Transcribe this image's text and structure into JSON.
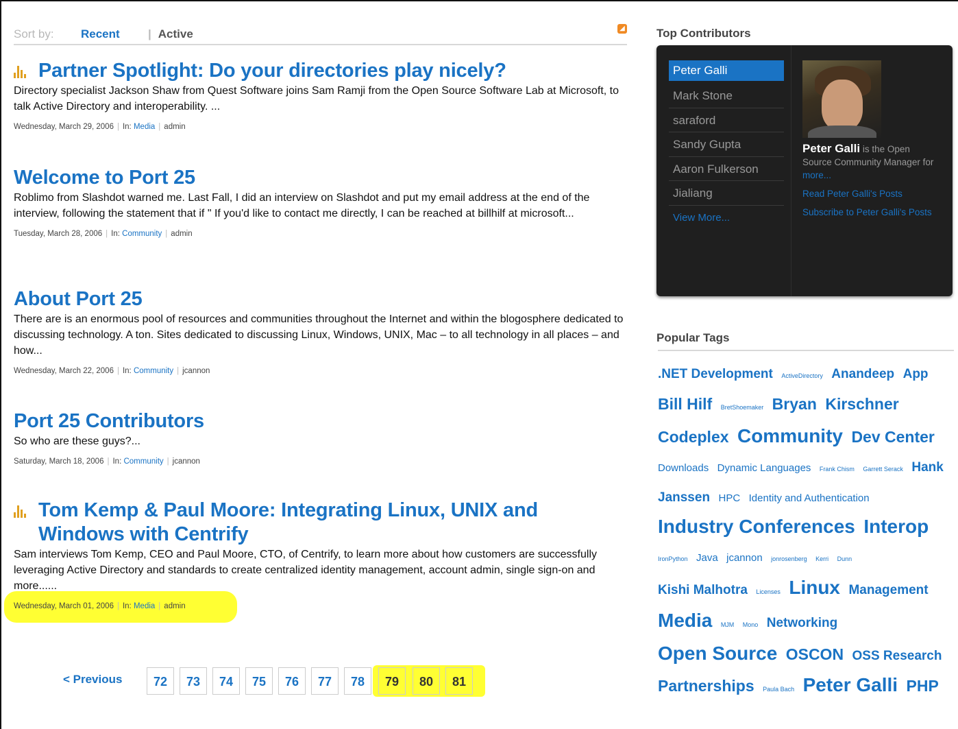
{
  "sort": {
    "label": "Sort by:",
    "recent": "Recent",
    "separator": "|",
    "active": "Active",
    "rss_icon": "rss-icon"
  },
  "posts": [
    {
      "title": "Partner Spotlight: Do your directories play nicely?",
      "featured": true,
      "excerpt": "Directory specialist Jackson Shaw from Quest Software joins Sam Ramji from the Open Source Software Lab at Microsoft, to talk Active Directory and interoperability. ...",
      "date": "Wednesday, March 29, 2006",
      "in": "In:",
      "category": "Media",
      "author": "admin"
    },
    {
      "title": "Welcome to Port 25",
      "featured": false,
      "excerpt": "Roblimo from Slashdot warned me. Last Fall, I did an interview on Slashdot and put my email address at the end of the interview, following the statement that if \" If you'd like to contact me directly, I can be reached at billhilf at microsoft...",
      "date": "Tuesday, March 28, 2006",
      "in": "In:",
      "category": "Community",
      "author": "admin"
    },
    {
      "title": "About Port 25",
      "featured": false,
      "excerpt": "There are is an enormous pool of resources and communities throughout the Internet and within the blogosphere dedicated to discussing technology. A ton. Sites dedicated to discussing Linux, Windows, UNIX, Mac – to all technology in all places – and how...",
      "date": "Wednesday, March 22, 2006",
      "in": "In:",
      "category": "Community",
      "author": "jcannon"
    },
    {
      "title": "Port 25 Contributors",
      "featured": false,
      "excerpt": "So who are these guys?...",
      "date": "Saturday, March 18, 2006",
      "in": "In:",
      "category": "Community",
      "author": "jcannon"
    },
    {
      "title": "Tom Kemp & Paul Moore: Integrating Linux, UNIX and Windows with Centrify",
      "featured": true,
      "excerpt": "Sam interviews Tom Kemp, CEO and Paul Moore, CTO, of Centrify, to learn more about how customers are successfully leveraging Active Directory and standards to create centralized identity management, account admin, single sign-on and more......",
      "date": "Wednesday, March 01, 2006",
      "in": "In:",
      "category": "Media",
      "author": "admin"
    }
  ],
  "pager": {
    "previous": "< Previous",
    "pages": [
      "72",
      "73",
      "74",
      "75",
      "76",
      "77",
      "78",
      "79",
      "80",
      "81"
    ]
  },
  "contributors": {
    "heading": "Top Contributors",
    "names": [
      "Peter Galli",
      "Mark Stone",
      "saraford",
      "Sandy Gupta",
      "Aaron Fulkerson",
      "Jialiang"
    ],
    "view_more": "View More...",
    "selected_name": "Peter Galli",
    "bio": "is the Open Source Community Manager for",
    "bio_more": "more...",
    "read_posts": "Read Peter Galli's Posts",
    "subscribe": "Subscribe to Peter Galli's Posts"
  },
  "tags": {
    "heading": "Popular Tags",
    "items": [
      [
        ".NET Development",
        3
      ],
      [
        "ActiveDirectory",
        1
      ],
      [
        "Anandeep",
        3
      ],
      [
        "App",
        3
      ],
      [
        "Bill Hilf",
        4
      ],
      [
        "BretShoemaker",
        1
      ],
      [
        "Bryan",
        4
      ],
      [
        "Kirschner",
        4
      ],
      [
        "Codeplex",
        4
      ],
      [
        "Community",
        5
      ],
      [
        "Dev Center",
        4
      ],
      [
        "Downloads",
        2
      ],
      [
        "Dynamic Languages",
        2
      ],
      [
        "Frank Chism",
        1
      ],
      [
        "Garrett Serack",
        1
      ],
      [
        "Hank",
        3
      ],
      [
        "Janssen",
        3
      ],
      [
        "HPC",
        2
      ],
      [
        "Identity and Authentication",
        2
      ],
      [
        "Industry Conferences",
        5
      ],
      [
        "Interop",
        5
      ],
      [
        "IronPython",
        1
      ],
      [
        "Java",
        2
      ],
      [
        "jcannon",
        2
      ],
      [
        "jonrosenberg",
        1
      ],
      [
        "Kerri",
        1
      ],
      [
        "Dunn",
        1
      ],
      [
        "Kishi Malhotra",
        3
      ],
      [
        "Licenses",
        1
      ],
      [
        "Linux",
        5
      ],
      [
        "Management",
        3
      ],
      [
        "Media",
        5
      ],
      [
        "MJM",
        1
      ],
      [
        "Mono",
        1
      ],
      [
        "Networking",
        3
      ],
      [
        "Open Source",
        5
      ],
      [
        "OSCON",
        4
      ],
      [
        "OSS Research",
        3
      ],
      [
        "Partnerships",
        4
      ],
      [
        "Paula Bach",
        1
      ],
      [
        "Peter Galli",
        5
      ],
      [
        "PHP",
        4
      ]
    ]
  }
}
